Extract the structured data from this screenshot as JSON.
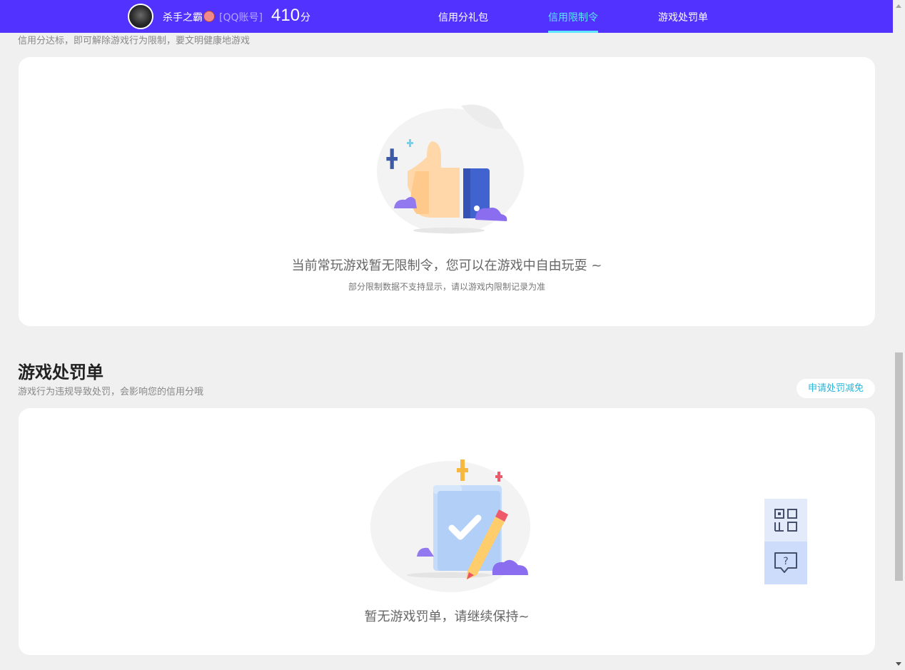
{
  "header": {
    "username": "杀手之霸",
    "account_type": "[QQ账号]",
    "score": "410",
    "score_unit": "分",
    "nav": [
      {
        "label": "信用分礼包",
        "active": false
      },
      {
        "label": "信用限制令",
        "active": true
      },
      {
        "label": "游戏处罚单",
        "active": false
      }
    ],
    "accent_color": "#5232ff",
    "active_color": "#5ee6ff"
  },
  "restriction_section": {
    "subtitle": "信用分达标，即可解除游戏行为限制，要文明健康地游戏",
    "empty_message": "当前常玩游戏暂无限制令，您可以在游戏中自由玩耍 ~",
    "note": "部分限制数据不支持显示，请以游戏内限制记录为准",
    "illustration": "thumbs-up-illustration"
  },
  "penalty_section": {
    "title": "游戏处罚单",
    "subtitle": "游戏行为违规导致处罚，会影响您的信用分哦",
    "appeal_button": "申请处罚减免",
    "empty_message": "暂无游戏罚单，请继续保持~",
    "illustration": "checklist-pencil-illustration"
  },
  "float_tools": [
    {
      "icon": "qr-code-icon"
    },
    {
      "icon": "help-chat-icon"
    }
  ]
}
